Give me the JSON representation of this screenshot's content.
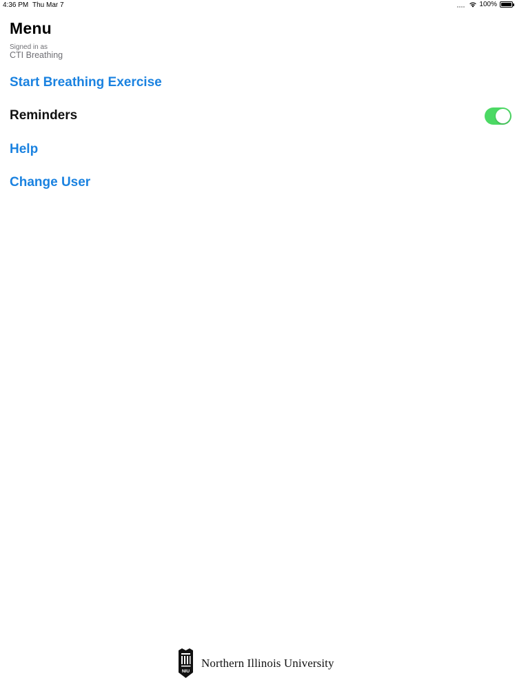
{
  "status_bar": {
    "time": "4:36 PM",
    "date": "Thu Mar 7",
    "battery": "100%"
  },
  "header": {
    "title": "Menu",
    "signed_in_label": "Signed in as",
    "user_name": "CTI Breathing"
  },
  "menu": {
    "start_exercise": "Start Breathing Exercise",
    "reminders": "Reminders",
    "reminders_enabled": true,
    "help": "Help",
    "change_user": "Change User"
  },
  "footer": {
    "logo_text": "NIU",
    "university_name": "Northern Illinois University"
  },
  "colors": {
    "link": "#1a82e0",
    "toggle_on": "#4cd964",
    "secondary_text": "#6e6e73"
  }
}
